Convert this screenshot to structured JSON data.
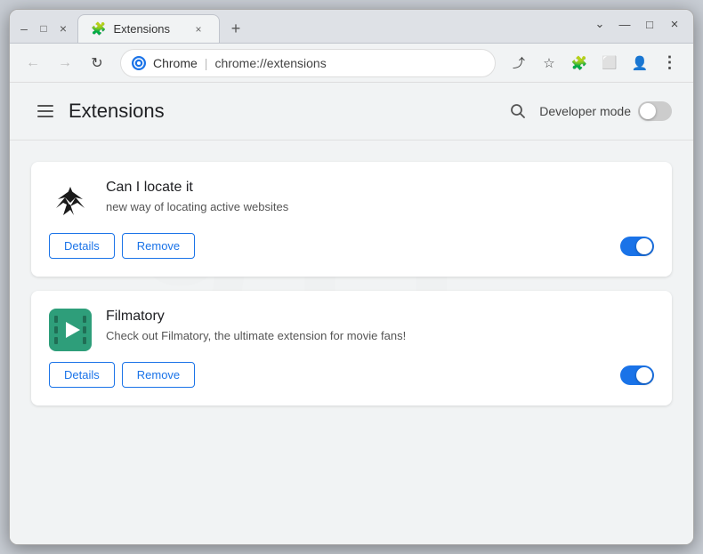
{
  "window": {
    "title": "Extensions",
    "tab_title": "Extensions",
    "close_label": "×",
    "minimize_label": "–",
    "maximize_label": "□",
    "dropdown_label": "⌄"
  },
  "nav": {
    "back_label": "←",
    "forward_label": "→",
    "refresh_label": "↻",
    "browser_name": "Chrome",
    "url": "chrome://extensions",
    "share_label": "⤴",
    "bookmark_label": "☆",
    "extensions_label": "🧩",
    "profile_label": "👤",
    "menu_label": "⋮"
  },
  "page": {
    "header": {
      "title": "Extensions",
      "dev_mode_label": "Developer mode"
    },
    "extensions": [
      {
        "id": "can-i-locate-it",
        "name": "Can I locate it",
        "description": "new way of locating active websites",
        "details_label": "Details",
        "remove_label": "Remove",
        "enabled": true
      },
      {
        "id": "filmatory",
        "name": "Filmatory",
        "description": "Check out Filmatory, the ultimate extension for movie fans!",
        "details_label": "Details",
        "remove_label": "Remove",
        "enabled": true
      }
    ]
  }
}
